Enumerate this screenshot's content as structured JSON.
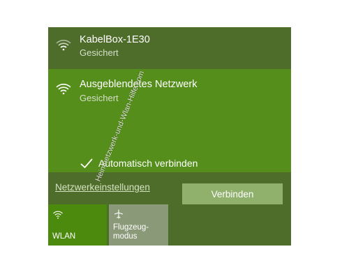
{
  "networks": [
    {
      "ssid": "KabelBox-1E30",
      "status": "Gesichert",
      "icon": "wifi-signal-icon"
    },
    {
      "ssid": "Ausgeblendetes Netzwerk",
      "status": "Gesichert",
      "icon": "wifi-signal-icon"
    }
  ],
  "selected": {
    "auto_connect_label": "Automatisch verbinden",
    "auto_connect_checked": true,
    "connect_button": "Verbinden"
  },
  "settings_link": "Netzwerkeinstellungen",
  "quick_actions": [
    {
      "label": "WLAN",
      "icon": "wifi-icon",
      "active": true
    },
    {
      "label_line1": "Flugzeug-",
      "label_line2": "modus",
      "icon": "airplane-icon",
      "active": false
    }
  ],
  "watermark": "Heimnetzwerk-und-Wlan-Hilfe.com",
  "colors": {
    "flyout_bg": "#4f6d2a",
    "selected_bg": "#568e1b",
    "button_bg": "#8fb16c",
    "wlan_tile": "#4c8a0e",
    "plane_tile": "#8a9a79"
  }
}
